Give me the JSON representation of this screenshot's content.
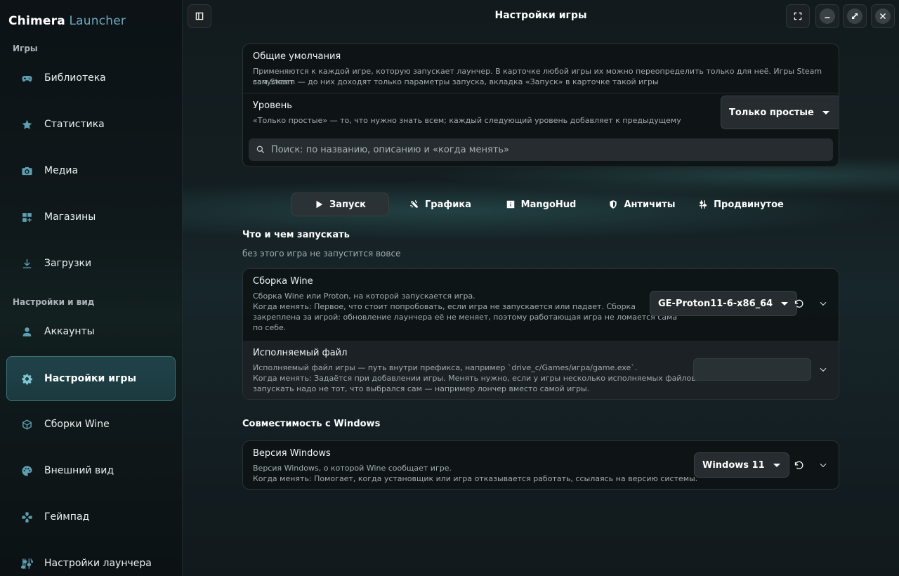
{
  "app": {
    "brand_main": "Chimera",
    "brand_sub": "Launcher"
  },
  "sidebar": {
    "section_games": "Игры",
    "section_settings": "Настройки и вид",
    "items": [
      {
        "label": "Библиотека",
        "icon": "gamepad-icon"
      },
      {
        "label": "Статистика",
        "icon": "star-icon"
      },
      {
        "label": "Медиа",
        "icon": "camera-icon"
      },
      {
        "label": "Магазины",
        "icon": "apps-icon"
      },
      {
        "label": "Загрузки",
        "icon": "download-icon"
      },
      {
        "label": "Аккаунты",
        "icon": "user-icon"
      },
      {
        "label": "Настройки игры",
        "icon": "gear-icon",
        "active": true
      },
      {
        "label": "Сборки Wine",
        "icon": "cube-icon"
      },
      {
        "label": "Внешний вид",
        "icon": "palette-icon"
      },
      {
        "label": "Геймпад",
        "icon": "dpad-icon"
      },
      {
        "label": "Настройки лаунчера",
        "icon": "settings-cog-icon"
      }
    ]
  },
  "header": {
    "title": "Настройки игры"
  },
  "defaults_card": {
    "title": "Общие умолчания",
    "desc_line1": "Применяются к каждой игре, которую запускает лаунчер. В карточке любой игры их можно переопределить только для неё. Игры Steam запускает",
    "desc_line2": "сам Steam — до них доходят только параметры запуска, вкладка «Запуск» в карточке такой игры",
    "level_title": "Уровень",
    "level_desc": "«Только простые» — то, что нужно знать всем; каждый следующий уровень добавляет к предыдущему",
    "level_value": "Только простые",
    "search_placeholder": "Поиск: по названию, описанию и «когда менять»"
  },
  "tabs": [
    {
      "label": "Запуск",
      "icon": "play-icon",
      "active": true
    },
    {
      "label": "Графика",
      "icon": "graphics-icon"
    },
    {
      "label": "MangoHud",
      "icon": "info-icon"
    },
    {
      "label": "Античиты",
      "icon": "shield-icon"
    },
    {
      "label": "Продвинутое",
      "icon": "advanced-icon"
    }
  ],
  "launch_section": {
    "title": "Что и чем запускать",
    "subtitle": "без этого игра не запустится вовсе",
    "wine": {
      "title": "Сборка Wine",
      "desc1": "Сборка Wine или Proton, на которой запускается игра.",
      "desc2": "Когда менять: Первое, что стоит попробовать, если игра не запускается или падает. Сборка",
      "desc3": "закреплена за игрой: обновление лаунчера её не меняет, поэтому работающая игра не ломается сама",
      "desc4": "по себе.",
      "value": "GE-Proton11-6-x86_64"
    },
    "exe": {
      "title": "Исполняемый файл",
      "desc1": "Исполняемый файл игры — путь внутри префикса, например `drive_c/Games/игра/game.exe`.",
      "desc2": "Когда менять: Задаётся при добавлении игры. Менять нужно, если у игры несколько исполняемых файлов и",
      "desc3": "запускать надо не тот, что выбрался сам — например лончер вместо самой игры.",
      "value": ""
    }
  },
  "compat_section": {
    "title": "Совместимость с Windows",
    "winver": {
      "title": "Версия Windows",
      "desc1": "Версия Windows, о которой Wine сообщает игре.",
      "desc2": "Когда менять: Помогает, когда установщик или игра отказывается работать, ссылаясь на версию системы.",
      "value": "Windows 11"
    }
  }
}
